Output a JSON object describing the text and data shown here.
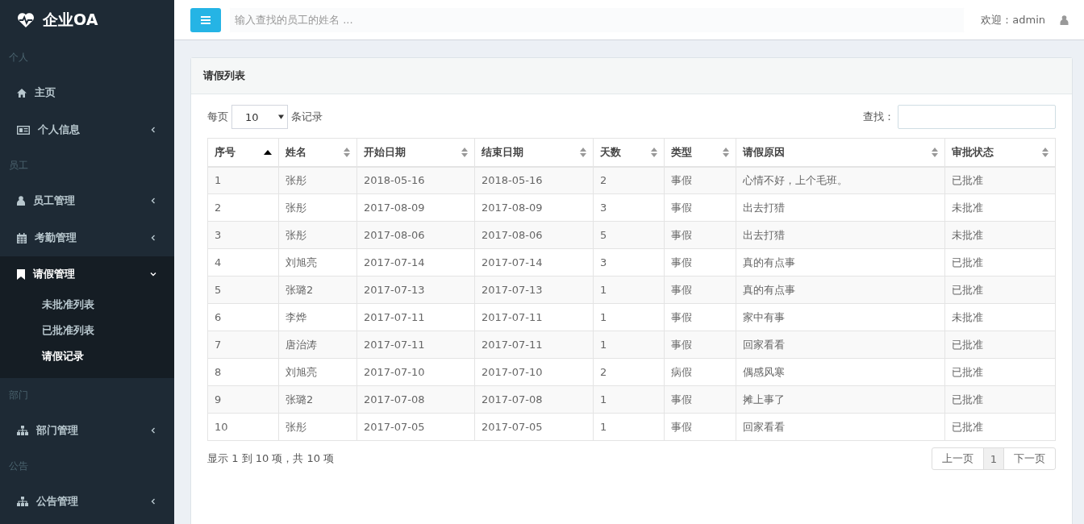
{
  "sidebar": {
    "logo": "企业OA",
    "sections": [
      {
        "header": "个人",
        "items": [
          {
            "kind": "home",
            "label": "主页",
            "has_caret": false,
            "expanded": false
          },
          {
            "kind": "card",
            "label": "个人信息",
            "has_caret": true,
            "expanded": false
          }
        ]
      },
      {
        "header": "员工",
        "items": [
          {
            "kind": "user",
            "label": "员工管理",
            "has_caret": true,
            "expanded": false
          },
          {
            "kind": "calendar",
            "label": "考勤管理",
            "has_caret": true,
            "expanded": false
          },
          {
            "kind": "bookmark",
            "label": "请假管理",
            "has_caret": true,
            "expanded": true,
            "children": [
              {
                "label": "未批准列表",
                "selected": false
              },
              {
                "label": "已批准列表",
                "selected": false
              },
              {
                "label": "请假记录",
                "selected": true
              }
            ]
          }
        ]
      },
      {
        "header": "部门",
        "items": [
          {
            "kind": "sitemap",
            "label": "部门管理",
            "has_caret": true,
            "expanded": false
          }
        ]
      },
      {
        "header": "公告",
        "items": [
          {
            "kind": "sitemap",
            "label": "公告管理",
            "has_caret": true,
            "expanded": false
          }
        ]
      }
    ]
  },
  "topbar": {
    "search": {
      "placeholder": "输入查找的员工的姓名 ..."
    },
    "welcome": "欢迎：admin"
  },
  "panel": {
    "title": "请假列表",
    "length_prefix": "每页",
    "length_value": "10",
    "length_suffix": "条记录",
    "search_label": "查找：",
    "columns": [
      {
        "label": "序号",
        "sorted": true
      },
      {
        "label": "姓名",
        "sorted": false
      },
      {
        "label": "开始日期",
        "sorted": false
      },
      {
        "label": "结束日期",
        "sorted": false
      },
      {
        "label": "天数",
        "sorted": false
      },
      {
        "label": "类型",
        "sorted": false
      },
      {
        "label": "请假原因",
        "sorted": false
      },
      {
        "label": "审批状态",
        "sorted": false
      }
    ],
    "rows": [
      [
        "1",
        "张彤",
        "2018-05-16",
        "2018-05-16",
        "2",
        "事假",
        "心情不好，上个毛班。",
        "已批准"
      ],
      [
        "2",
        "张彤",
        "2017-08-09",
        "2017-08-09",
        "3",
        "事假",
        "出去打猎",
        "未批准"
      ],
      [
        "3",
        "张彤",
        "2017-08-06",
        "2017-08-06",
        "5",
        "事假",
        "出去打猎",
        "未批准"
      ],
      [
        "4",
        "刘旭亮",
        "2017-07-14",
        "2017-07-14",
        "3",
        "事假",
        "真的有点事",
        "已批准"
      ],
      [
        "5",
        "张璐2",
        "2017-07-13",
        "2017-07-13",
        "1",
        "事假",
        "真的有点事",
        "已批准"
      ],
      [
        "6",
        "李烨",
        "2017-07-11",
        "2017-07-11",
        "1",
        "事假",
        "家中有事",
        "未批准"
      ],
      [
        "7",
        "唐治涛",
        "2017-07-11",
        "2017-07-11",
        "1",
        "事假",
        "回家看看",
        "已批准"
      ],
      [
        "8",
        "刘旭亮",
        "2017-07-10",
        "2017-07-10",
        "2",
        "病假",
        "偶感风寒",
        "已批准"
      ],
      [
        "9",
        "张璐2",
        "2017-07-08",
        "2017-07-08",
        "1",
        "事假",
        "摊上事了",
        "已批准"
      ],
      [
        "10",
        "张彤",
        "2017-07-05",
        "2017-07-05",
        "1",
        "事假",
        "回家看看",
        "已批准"
      ]
    ],
    "info": "显示 1 到 10 项，共 10 项",
    "pagination": [
      {
        "label": "上一页",
        "selected": false
      },
      {
        "label": "1",
        "selected": true
      },
      {
        "label": "下一页",
        "selected": false
      }
    ]
  }
}
